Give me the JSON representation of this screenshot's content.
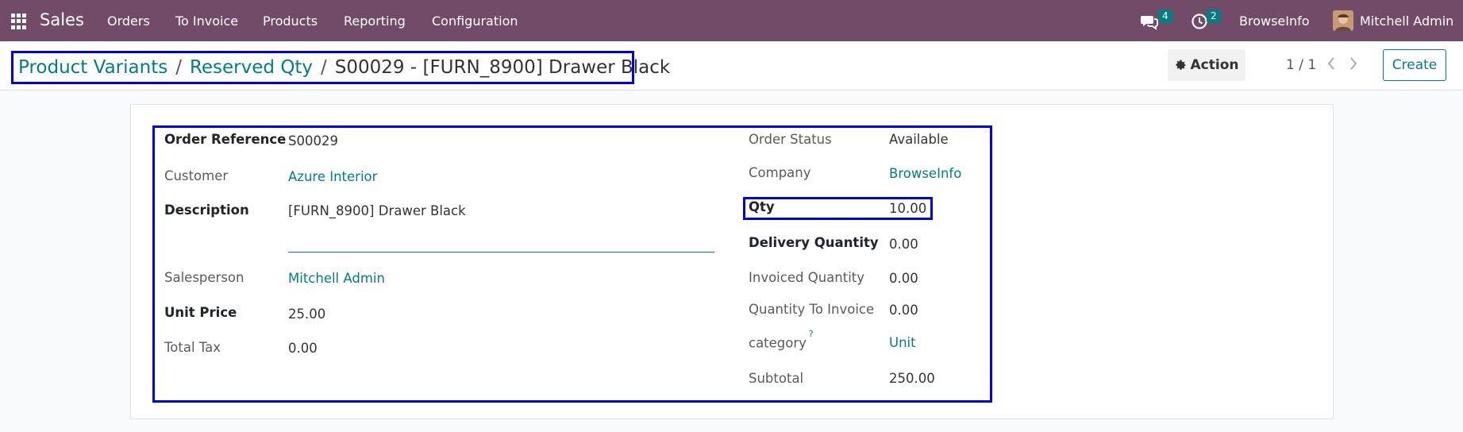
{
  "navbar": {
    "app_name": "Sales",
    "menu": [
      "Orders",
      "To Invoice",
      "Products",
      "Reporting",
      "Configuration"
    ],
    "messages_count": "4",
    "activities_count": "2",
    "company": "BrowseInfo",
    "user": "Mitchell Admin",
    "bg_color": "#714b67"
  },
  "control_panel": {
    "breadcrumb": {
      "item1": "Product Variants",
      "sep": "/",
      "item2": "Reserved Qty",
      "current": "S00029 - [FURN_8900] Drawer Black"
    },
    "action_label": "Action",
    "pager": "1 / 1",
    "create_label": "Create"
  },
  "form": {
    "left": {
      "order_reference_label": "Order Reference",
      "order_reference_value": "S00029",
      "customer_label": "Customer",
      "customer_value": "Azure Interior",
      "description_label": "Description",
      "description_value": "[FURN_8900] Drawer Black",
      "salesperson_label": "Salesperson",
      "salesperson_value": "Mitchell Admin",
      "unit_price_label": "Unit Price",
      "unit_price_value": "25.00",
      "total_tax_label": "Total Tax",
      "total_tax_value": "0.00"
    },
    "right": {
      "order_status_label": "Order Status",
      "order_status_value": "Available",
      "company_label": "Company",
      "company_value": "BrowseInfo",
      "qty_label": "Qty",
      "qty_value": "10.00",
      "delivery_qty_label": "Delivery Quantity",
      "delivery_qty_value": "0.00",
      "invoiced_qty_label": "Invoiced Quantity",
      "invoiced_qty_value": "0.00",
      "qty_to_invoice_label": "Quantity To Invoice",
      "qty_to_invoice_value": "0.00",
      "category_label": "category",
      "category_help": "?",
      "category_value": "Unit",
      "subtotal_label": "Subtotal",
      "subtotal_value": "250.00"
    }
  },
  "colors": {
    "accent": "#017e84",
    "highlight_border": "#0000ee"
  }
}
